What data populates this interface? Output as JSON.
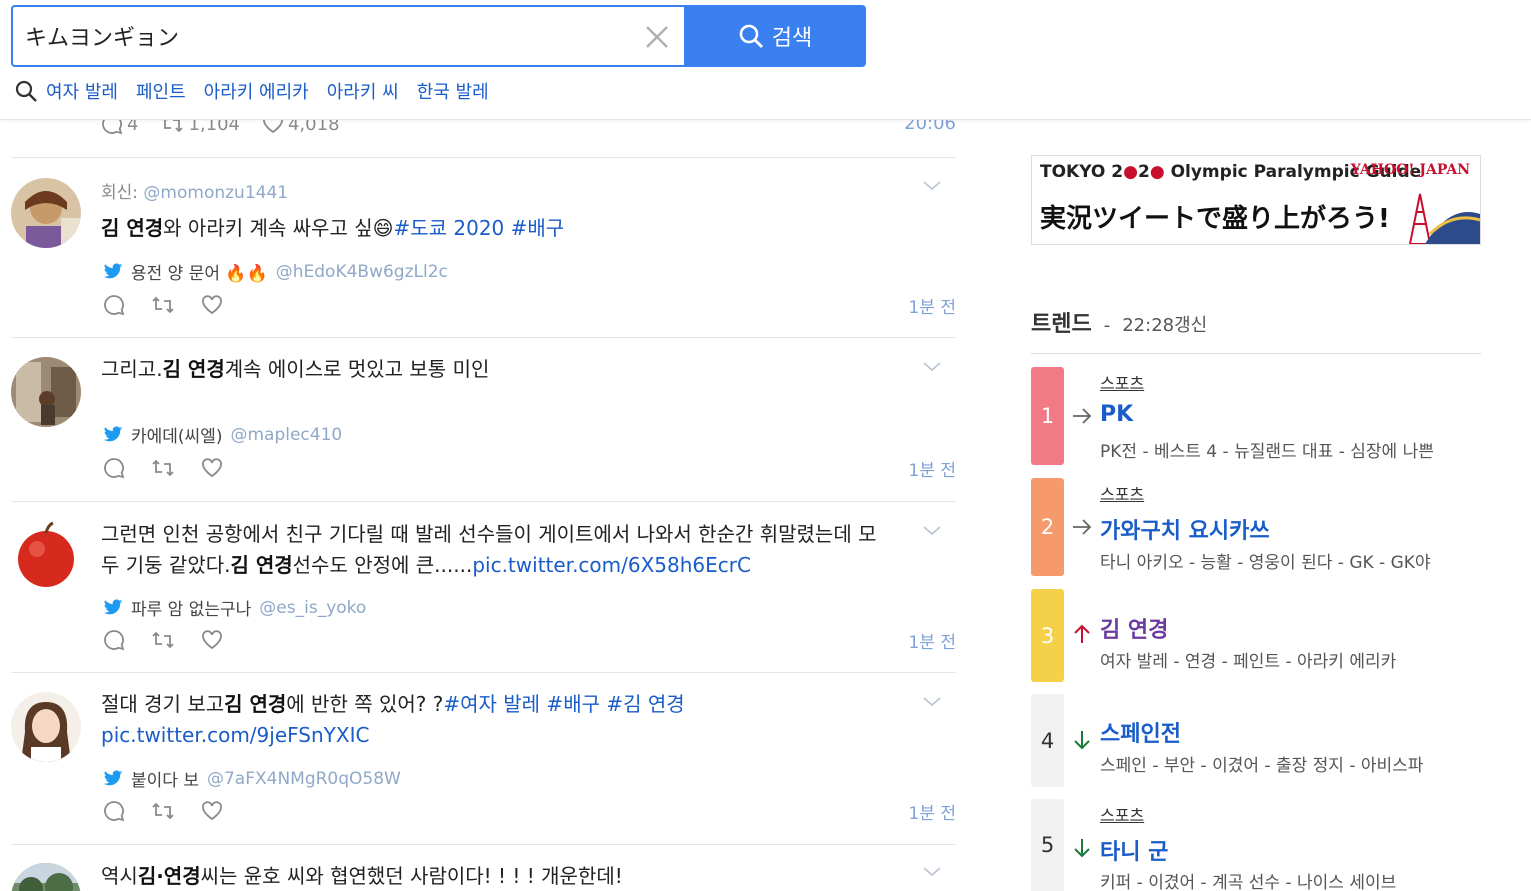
{
  "search": {
    "value": "キムヨンギョン",
    "button_label": "검색"
  },
  "related_searches": [
    "여자 발레",
    "페인트",
    "아라키 에리카",
    "아라키 씨",
    "한국 발레"
  ],
  "cut_tweet": {
    "replies": "4",
    "retweets": "1,104",
    "likes": "4,018",
    "time": "20:06"
  },
  "tweets": [
    {
      "reply_prefix": "회신:",
      "reply_handle": "@momonzu1441",
      "bold": "김 연경",
      "text": "와 아라키 계속 싸우고 싶",
      "emoji": "😄",
      "tags": "#도쿄 2020 #배구",
      "author_name": "용전 양 문어 🔥🔥",
      "author_handle": "@hEdoK4Bw6gzLl2c",
      "time": "1분 전"
    },
    {
      "pre": "그리고.",
      "bold": "김 연경",
      "text": "계속 에이스로 멋있고 보통 미인",
      "author_name": "카에데(씨엘)",
      "author_handle": "@maplec410",
      "time": "1분 전"
    },
    {
      "pre": "그런면 인천 공항에서 친구 기다릴 때 발레 선수들이 게이트에서 나와서 한순간 휘말렸는데 모두 기둥 같았다.",
      "bold": "김 연경",
      "text": "선수도 안정에 큰......",
      "link": "pic.twitter.com/6X58h6EcrC",
      "author_name": "파루 암 없는구나",
      "author_handle": "@es_is_yoko",
      "time": "1분 전"
    },
    {
      "pre": "절대 경기 보고",
      "bold": "김 연경",
      "text": "에 반한 쪽 있어? ?",
      "tags": "#여자 발레 #배구 #김 연경",
      "link": "pic.twitter.com/9jeFSnYXIC",
      "author_name": "붙이다 보",
      "author_handle": "@7aFX4NMgR0qO58W",
      "time": "1분 전"
    },
    {
      "pre": "역시",
      "bold": "김·연경",
      "text": "씨는 윤호 씨와 협연했던 사람이다! ! ! ! 개운한데!"
    }
  ],
  "banner": {
    "line1_a": "TOKYO 2",
    "line1_b": "2",
    "line1_c": " Olympic Paralympic Guide",
    "line2": "実況ツイートで盛り上がろう!",
    "logo": "YAHOO! JAPAN"
  },
  "trends_header": {
    "title": "트렌드",
    "sep": "-",
    "updated": "22:28갱신"
  },
  "trends": [
    {
      "rank": "1",
      "category": "스포츠",
      "keyword": "PK",
      "related": "PK전 - 베스트 4 - 뉴질랜드 대표 - 심장에 나쁜",
      "trend": "same",
      "color": "#f27a85"
    },
    {
      "rank": "2",
      "category": "스포츠",
      "keyword": "가와구치 요시카쓰",
      "related": "타니 아키오 - 능활 - 영웅이 된다 - GK - GK야",
      "trend": "same",
      "color": "#f79a6b"
    },
    {
      "rank": "3",
      "category": "",
      "keyword": "김 연경",
      "related": "여자 발레 - 연경 - 페인트 - 아라키 에리카",
      "trend": "up",
      "color": "#f5d14a"
    },
    {
      "rank": "4",
      "category": "",
      "keyword": "스페인전",
      "related": "스페인 - 부안 - 이겼어 - 출장 정지 - 아비스파",
      "trend": "down",
      "color": "#f2f2f2"
    },
    {
      "rank": "5",
      "category": "스포츠",
      "keyword": "타니 군",
      "related": "키퍼 - 이겼어 - 계곡 선수 - 나이스 세이브",
      "trend": "down",
      "color": "#f2f2f2"
    }
  ]
}
